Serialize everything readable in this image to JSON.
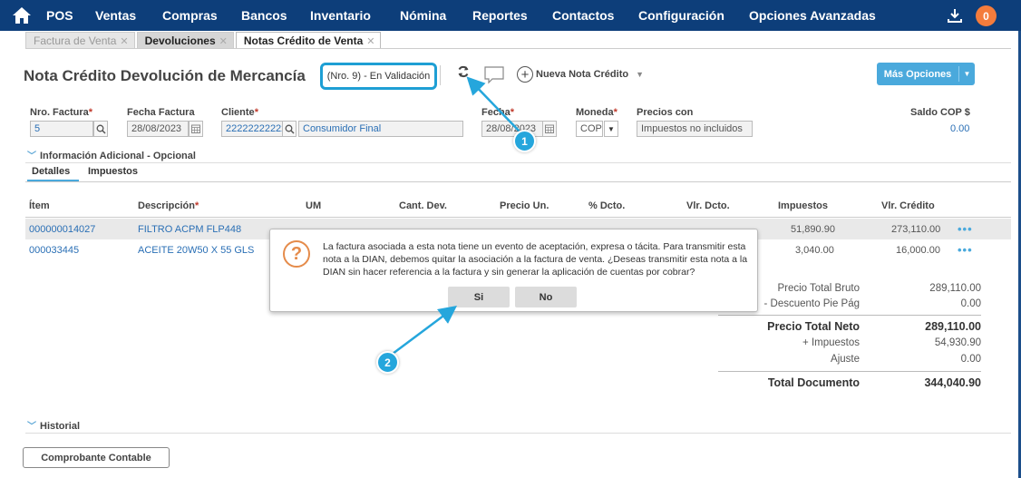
{
  "nav": {
    "items": [
      "POS",
      "Ventas",
      "Compras",
      "Bancos",
      "Inventario",
      "Nómina",
      "Reportes",
      "Contactos",
      "Configuración",
      "Opciones Avanzadas"
    ],
    "badge": "0"
  },
  "tabs": [
    "Factura de Venta",
    "Devoluciones",
    "Notas Crédito de Venta"
  ],
  "header": {
    "title": "Nota Crédito Devolución de Mercancía",
    "status": "(Nro. 9) - En Validación",
    "new_label": "Nueva Nota Crédito",
    "more_label": "Más Opciones"
  },
  "form": {
    "nro_label": "Nro. Factura",
    "nro_value": "5",
    "fecha_factura_label": "Fecha Factura",
    "fecha_factura_value": "28/08/2023",
    "cliente_label": "Cliente",
    "cliente_id": "222222222222",
    "cliente_name": "Consumidor Final",
    "fecha_label": "Fecha",
    "fecha_value": "28/08/2023",
    "moneda_label": "Moneda",
    "moneda_value": "COP",
    "precios_label": "Precios con",
    "precios_value": "Impuestos no incluidos",
    "saldo_label": "Saldo COP $",
    "saldo_value": "0.00",
    "required_mark": "*"
  },
  "sections": {
    "info_adicional": "Información Adicional - Opcional",
    "detalles": "Detalles",
    "impuestos": "Impuestos",
    "historial": "Historial"
  },
  "table": {
    "headers": [
      "Ítem",
      "Descripción",
      "UM",
      "Cant. Dev.",
      "Precio Un.",
      "% Dcto.",
      "Vlr. Dcto.",
      "Impuestos",
      "Vlr. Crédito"
    ],
    "rows": [
      {
        "item": "000000014027",
        "desc": "FILTRO ACPM FLP448",
        "impuestos": "51,890.90",
        "credito": "273,110.00"
      },
      {
        "item": "000033445",
        "desc": "ACEITE 20W50 X 55 GLS",
        "impuestos": "3,040.00",
        "credito": "16,000.00"
      }
    ],
    "dots": "•••"
  },
  "totals": {
    "bruto_label": "Precio Total Bruto",
    "bruto_value": "289,110.00",
    "desc_label": "- Descuento Pie Pág",
    "desc_value": "0.00",
    "neto_label": "Precio Total Neto",
    "neto_value": "289,110.00",
    "imp_label": "+ Impuestos",
    "imp_value": "54,930.90",
    "ajuste_label": "Ajuste",
    "ajuste_value": "0.00",
    "doc_label": "Total Documento",
    "doc_value": "344,040.90"
  },
  "comprobante": "Comprobante Contable",
  "dialog": {
    "message": "La factura asociada a esta nota tiene un evento de aceptación, expresa o tácita. Para transmitir esta nota a la DIAN, debemos quitar la asociación a la factura de venta. ¿Deseas transmitir esta nota a la DIAN sin hacer referencia a la factura y sin generar la aplicación de cuentas por cobrar?",
    "yes": "Si",
    "no": "No"
  },
  "markers": [
    "1",
    "2"
  ],
  "colors": {
    "nav": "#0d3e7a",
    "accent": "#1e9fd4",
    "badge": "#f47c3c"
  }
}
